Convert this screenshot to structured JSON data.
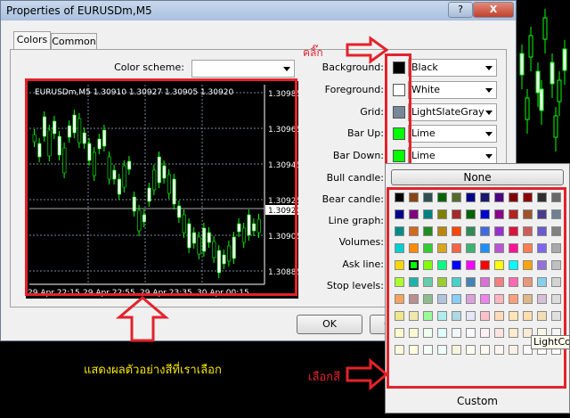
{
  "window": {
    "title": "Properties of EURUSDm,M5",
    "help_button": "?",
    "close_button": "X"
  },
  "tabs": [
    {
      "label": "Colors"
    },
    {
      "label": "Common"
    }
  ],
  "color_scheme": {
    "label": "Color scheme:",
    "value": ""
  },
  "preview": {
    "header": "EURUSDm,M5  1.30910 1.30927 1.30905 1.30920",
    "price_labels": [
      "1.30985",
      "1.30965",
      "1.30945",
      "1.30925",
      "1.30920",
      "1.30905",
      "1.30885"
    ],
    "time_labels": [
      "29 Apr 22:15",
      "29 Apr 22:55",
      "29 Apr 23:35",
      "30 Apr 00:15"
    ]
  },
  "properties": [
    {
      "label": "Background:",
      "value": "Black",
      "color": "#000000"
    },
    {
      "label": "Foreground:",
      "value": "White",
      "color": "#ffffff"
    },
    {
      "label": "Grid:",
      "value": "LightSlateGray",
      "color": "#778899"
    },
    {
      "label": "Bar Up:",
      "value": "Lime",
      "color": "#00ff00"
    },
    {
      "label": "Bar Down:",
      "value": "Lime",
      "color": "#00ff00"
    },
    {
      "label": "Bull candle:"
    },
    {
      "label": "Bear candle:"
    },
    {
      "label": "Line graph:"
    },
    {
      "label": "Volumes:"
    },
    {
      "label": "Ask line:"
    },
    {
      "label": "Stop levels:"
    }
  ],
  "buttons": {
    "ok": "OK",
    "partial": "C"
  },
  "palette": {
    "none_label": "None",
    "custom_label": "Custom",
    "tooltip": "LightCo",
    "rows": [
      [
        "#000000",
        "#8b4513",
        "#2f4f4f",
        "#006400",
        "#556b2f",
        "#00008b",
        "#191970",
        "#4b0082",
        "#800000",
        "#8b0000",
        "#2f2f2f",
        "#696969"
      ],
      [
        "#00008b",
        "#800080",
        "#008080",
        "#808000",
        "#a52a2a",
        "#006400",
        "#0000cd",
        "#8b008b",
        "#b22222",
        "#a0522d",
        "#483d8b",
        "#708090"
      ],
      [
        "#008b8b",
        "#d2691e",
        "#228b22",
        "#b8860b",
        "#ff4500",
        "#2e8b57",
        "#4169e1",
        "#9932cc",
        "#dc143c",
        "#cd5c5c",
        "#6a5acd",
        "#808080"
      ],
      [
        "#00ced1",
        "#ff8c00",
        "#32cd32",
        "#daa520",
        "#ff6347",
        "#3cb371",
        "#1e90ff",
        "#ba55d3",
        "#ff1493",
        "#ff7f50",
        "#7b68ee",
        "#a9a9a9"
      ],
      [
        "#ffd700",
        "#00ff00",
        "#7fff00",
        "#00ff7f",
        "#0000ff",
        "#ff00ff",
        "#ff0000",
        "#ffff00",
        "#00ffff",
        "#ffa500",
        "#9370db",
        "#c0c0c0"
      ],
      [
        "#adff2f",
        "#20b2aa",
        "#66cdaa",
        "#9acd32",
        "#48d1cc",
        "#4682b4",
        "#da70d6",
        "#f08080",
        "#ff69b4",
        "#e9967a",
        "#87ceeb",
        "#d3d3d3"
      ],
      [
        "#f4a460",
        "#bc8f8f",
        "#8fbc8f",
        "#b0c4de",
        "#87cefa",
        "#dda0dd",
        "#ee82ee",
        "#ffb6c1",
        "#ffa07a",
        "#deb887",
        "#d8bfd8",
        "#dcdcdc"
      ],
      [
        "#f0e68c",
        "#eee8aa",
        "#98fb98",
        "#afeeee",
        "#add8e6",
        "#e6e6fa",
        "#ffc0cb",
        "#ffdab9",
        "#ffe4b5",
        "#ffdead",
        "#f5deb3",
        "#e0e0e0"
      ],
      [
        "#fffacd",
        "#fafad2",
        "#f0fff0",
        "#e0ffff",
        "#f0f8ff",
        "#f8f8ff",
        "#fff0f5",
        "#ffe4e1",
        "#ffebcd",
        "#faebd7",
        "#fdf5e6",
        "#f5f5f5"
      ],
      [
        "#fff8dc",
        "#ffffe0",
        "#f5fffa",
        "#f0ffff",
        "#f5f5dc",
        "#fffff0",
        "#fffaf0",
        "#fff5ee",
        "#faf0e6",
        "#fffafa",
        "#ffffff",
        "#ffffff"
      ]
    ]
  },
  "annotations": {
    "click": "คลิ๊ก",
    "preview_note": "แสดงผลตัวอย่างสีที่เราเลือก",
    "choose_color": "เลือกสี",
    "arrow_color": "#e3222b",
    "text_color_note": "#f5e600"
  }
}
